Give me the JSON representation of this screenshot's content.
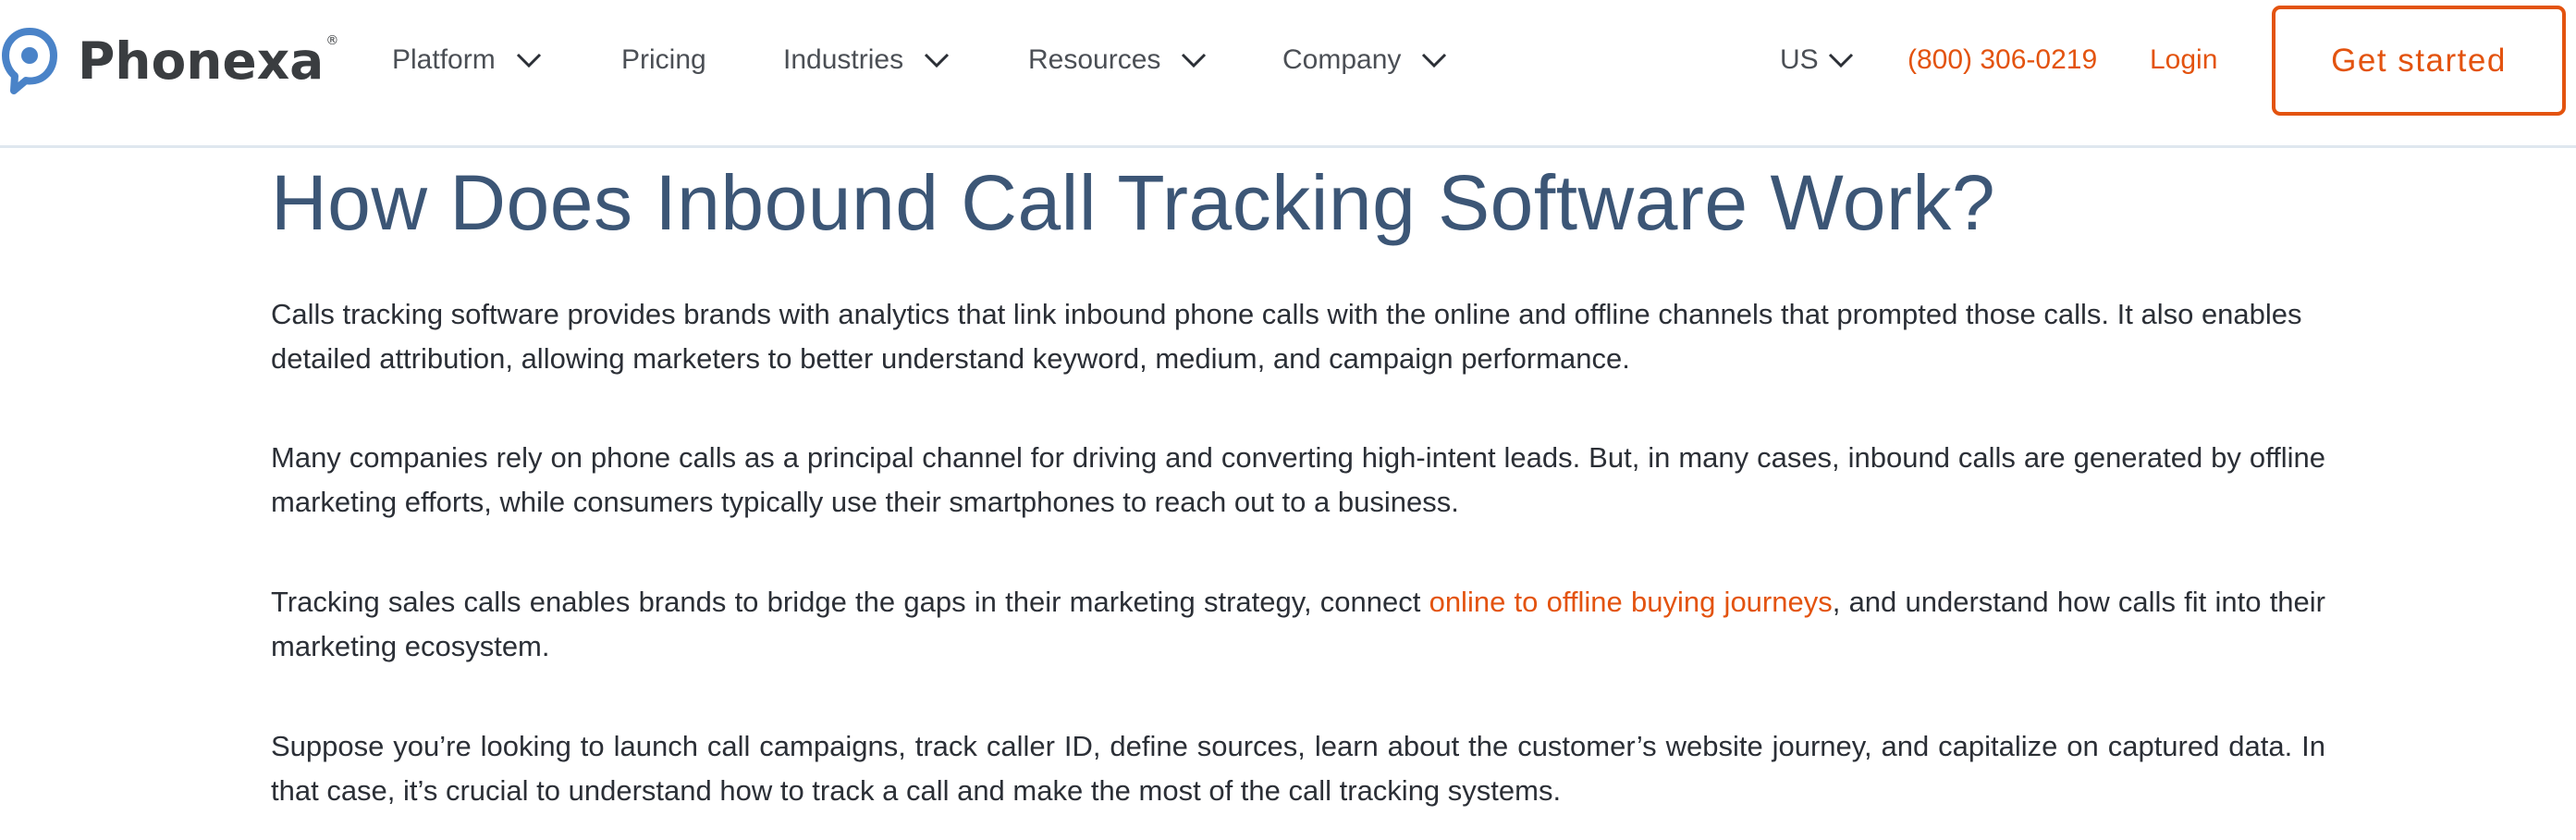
{
  "brand": {
    "name": "Phonexa",
    "registered_mark": "®",
    "logo_icon": "speech-bubble-pin-icon",
    "colors": {
      "logo_blue": "#4a83c8",
      "accent_orange": "#e3530f",
      "heading_blue": "#3c5676",
      "body_text": "#2b2f36",
      "nav_text": "#4b4f55"
    }
  },
  "header": {
    "nav": [
      {
        "label": "Platform",
        "has_dropdown": true
      },
      {
        "label": "Pricing",
        "has_dropdown": false
      },
      {
        "label": "Industries",
        "has_dropdown": true
      },
      {
        "label": "Resources",
        "has_dropdown": true
      },
      {
        "label": "Company",
        "has_dropdown": true
      }
    ],
    "locale": {
      "label": "US",
      "has_dropdown": true
    },
    "phone": "(800) 306-0219",
    "login_label": "Login",
    "cta_label": "Get started"
  },
  "article": {
    "title": "How Does Inbound Call Tracking Software Work?",
    "paragraphs": [
      {
        "text": "Calls tracking software provides brands with analytics that link inbound phone calls with the online and offline channels that prompted those calls. It also enables detailed attribution, allowing marketers to better understand keyword, medium, and campaign performance."
      },
      {
        "text": "Many companies rely on phone calls as a principal channel for driving and converting high-intent leads. But, in many cases, inbound calls are generated by offline marketing efforts, while consumers typically use their smartphones to reach out to a business."
      },
      {
        "before": "Tracking sales calls enables brands to bridge the gaps in their marketing strategy, connect ",
        "link": "online to offline buying journeys",
        "after": ", and understand how calls fit into their marketing ecosystem."
      },
      {
        "text": "Suppose you’re looking to launch call campaigns, track caller ID, define sources, learn about the customer’s website journey, and capitalize on captured data. In that case, it’s crucial to understand how to track a call and make the most of the call tracking systems."
      }
    ]
  }
}
